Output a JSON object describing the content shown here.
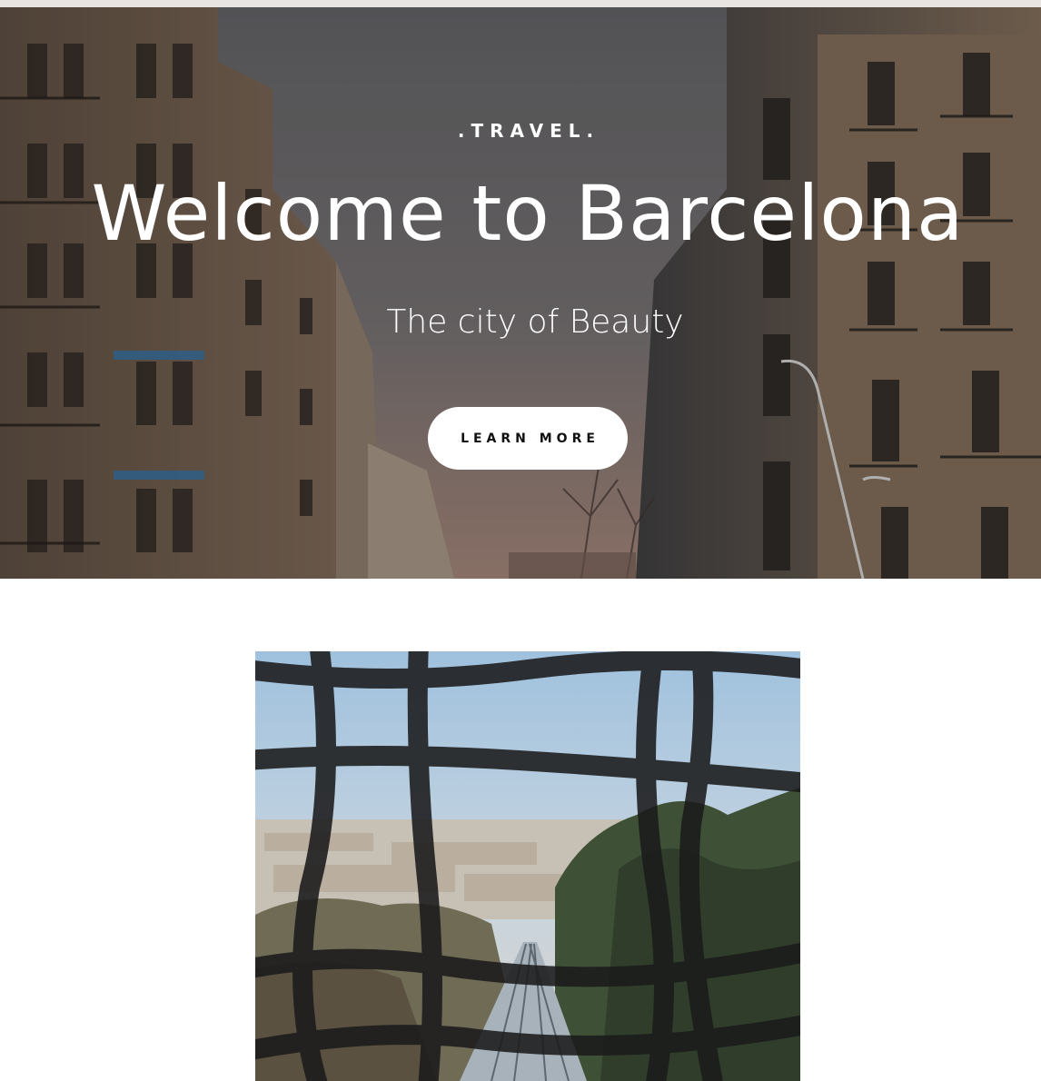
{
  "hero": {
    "eyebrow": ".TRAVEL.",
    "title": "Welcome to Barcelona",
    "subtitle": "The city of Beauty",
    "cta_label": "LEARN MORE"
  },
  "colors": {
    "cta_background": "#ffffff",
    "cta_text": "#111111",
    "hero_text": "#ffffff",
    "page_background": "#ffffff"
  }
}
